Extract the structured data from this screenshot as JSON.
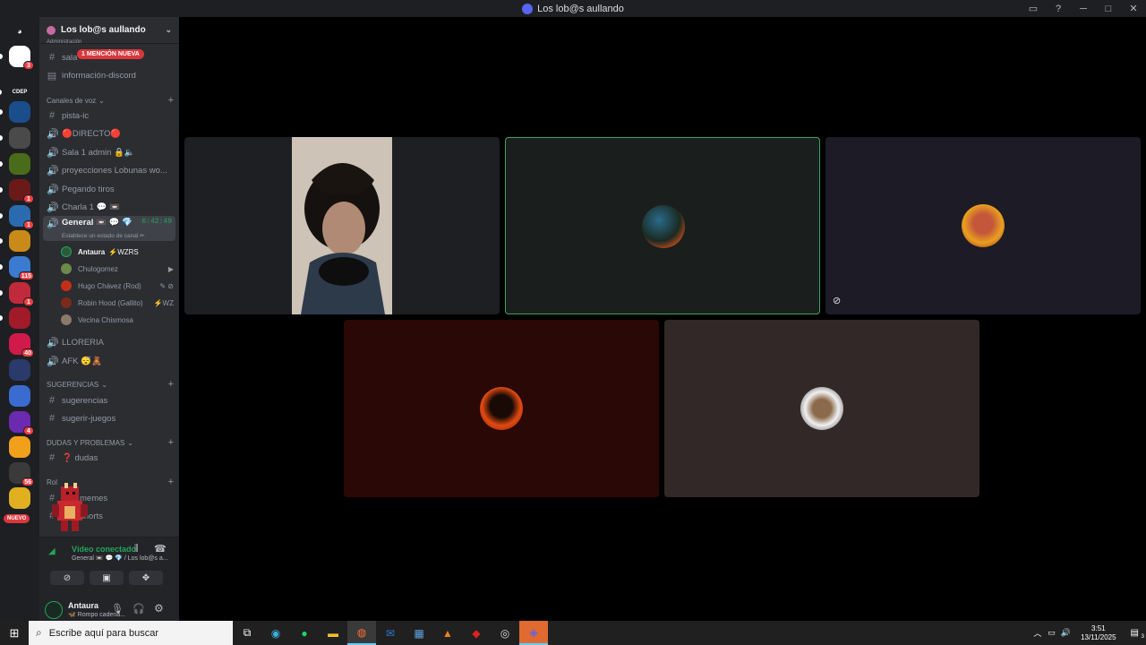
{
  "window": {
    "title": "Los lob@s aullando"
  },
  "server": {
    "name": "Los lob@s aullando",
    "mention_pill": "1 MENCIÓN NUEVA",
    "header_clip": "Administración"
  },
  "guilds": [
    {
      "label": "",
      "color": "#5865f2",
      "icon": "discord-home-icon"
    },
    {
      "label": "",
      "color": "#ffffff",
      "badge": "3",
      "icon": "user-avatar-icon"
    },
    {
      "label": "CDEP",
      "color": "#1e1f22",
      "icon": "cdep-server-icon"
    },
    {
      "label": "",
      "color": "#1a4d8c",
      "icon": "server-icon"
    },
    {
      "label": "",
      "color": "#4a4a4a",
      "icon": "server-icon"
    },
    {
      "label": "",
      "color": "#4a6b1a",
      "icon": "server-icon"
    },
    {
      "label": "",
      "color": "#6b1a1a",
      "badge": "1",
      "icon": "server-icon"
    },
    {
      "label": "",
      "color": "#2a6bb0",
      "badge": "1",
      "icon": "server-icon"
    },
    {
      "label": "",
      "color": "#c98a1a",
      "icon": "server-icon"
    },
    {
      "label": "",
      "color": "#3a7ad0",
      "badge": "115",
      "icon": "server-icon"
    },
    {
      "label": "",
      "color": "#c02a3a",
      "badge": "1",
      "icon": "server-icon"
    },
    {
      "label": "",
      "color": "#a01a2a",
      "icon": "server-icon"
    },
    {
      "label": "",
      "color": "#d01a4a",
      "badge": "40",
      "icon": "server-icon"
    },
    {
      "label": "",
      "color": "#2a3a6b",
      "icon": "server-icon"
    },
    {
      "label": "",
      "color": "#3a6bd0",
      "icon": "server-icon"
    },
    {
      "label": "",
      "color": "#6b2ab0",
      "badge": "4",
      "icon": "server-icon"
    },
    {
      "label": "",
      "color": "#f0a01a",
      "icon": "server-icon"
    },
    {
      "label": "",
      "color": "#3a3a3a",
      "badge": "56",
      "icon": "server-icon"
    },
    {
      "label": "",
      "color": "#e0b020",
      "icon": "crown-server-icon"
    }
  ],
  "guild_new_pill": "NUEVO",
  "channels": {
    "clipped_top": "sala",
    "info": "información-discord",
    "voice_category": "Canales de voz",
    "pista": "pista-ic",
    "directo": "🔴DIRECTO🔴",
    "sala_admin": "Sala 1 admin 🔒🔈",
    "proyecciones": "proyecciones Lobunas wo...",
    "pegando": "Pegando tiros",
    "charla": "Charla 1 💬 📼",
    "general": "General 📼 💬 💎",
    "general_timer": "6:42:49",
    "general_status": "Establece un estado de canal ✏",
    "lloreria": "LLORERIA",
    "afk": "AFK 😴🧸",
    "sugerencias_cat": "SUGERENCIAS",
    "sugerencias": "sugerencias",
    "sugerir": "sugerir-juegos",
    "dudas_cat": "DUDAS Y PROBLEMAS",
    "dudas": "❓ dudas",
    "rol_cat": "Rol",
    "memes": "memes",
    "shorts": "shorts"
  },
  "voice_users": [
    {
      "name": "Antaura",
      "extra": "⚡WZRS",
      "color": "#2b5a3a",
      "bold": true
    },
    {
      "name": "Chulogomez",
      "extra": "▶",
      "color": "#6b8a4a"
    },
    {
      "name": "Hugo Chávez (Rod)",
      "extra": "✎ ⊘",
      "color": "#c0301a"
    },
    {
      "name": "Robin Hood (Gallito)",
      "extra": "⚡WZ",
      "color": "#7a2a1a"
    },
    {
      "name": "Vecina Chismosa",
      "extra": "",
      "color": "#8a7a6a"
    }
  ],
  "voice_panel": {
    "status": "Vídeo conectado",
    "sub": "General 📼 💬 💎 / Los lob@s a..."
  },
  "user_panel": {
    "name": "Antaura",
    "status": "🦋 Rompo cadena..."
  },
  "tiles": [
    {
      "name": "camera-tile",
      "bg": "#1e1f22",
      "speaking": false
    },
    {
      "name": "speaking-tile",
      "bg": "#1a1e1c",
      "speaking": true
    },
    {
      "name": "avatar-tile-hugo",
      "bg": "#1c1b26",
      "speaking": false,
      "muted": true
    },
    {
      "name": "avatar-tile-robin",
      "bg": "#2a0806",
      "speaking": false
    },
    {
      "name": "avatar-tile-vecina",
      "bg": "#332828",
      "speaking": false
    }
  ],
  "taskbar": {
    "search_placeholder": "Escribe aquí para buscar",
    "time": "3:51",
    "date": "13/11/2025",
    "notif_count": "3"
  },
  "colors": {
    "speaking_border": "#3ba55d",
    "online": "#23a55a",
    "mention": "#da373c"
  }
}
